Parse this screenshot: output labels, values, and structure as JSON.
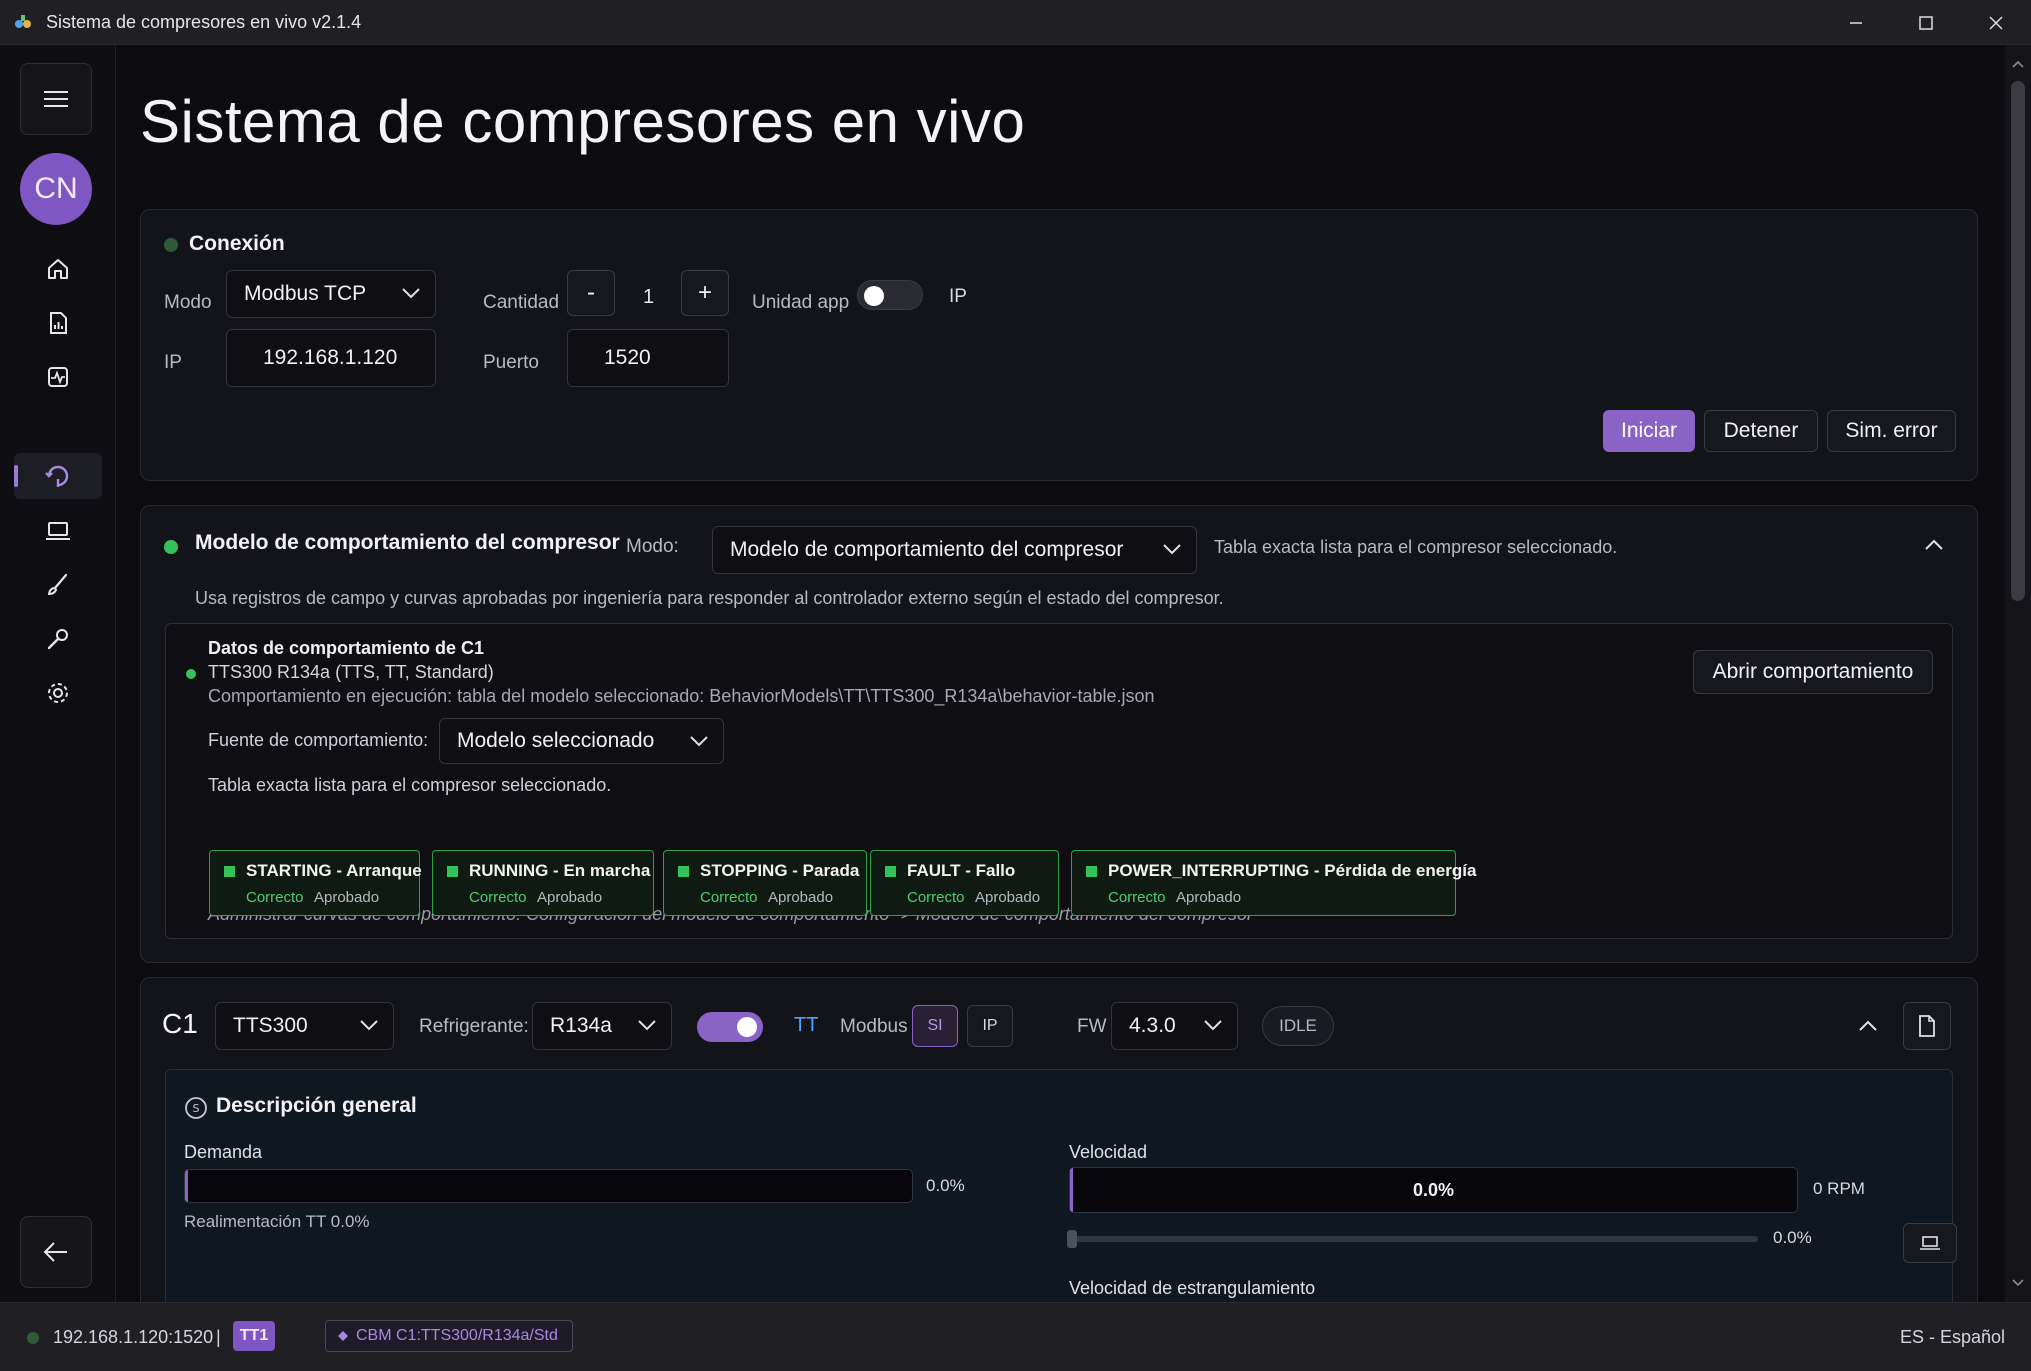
{
  "window": {
    "title": "Sistema de compresores en vivo v2.1.4",
    "minimize_icon": "minimize-icon",
    "maximize_icon": "maximize-icon",
    "close_icon": "close-icon"
  },
  "sidebar": {
    "avatar_initials": "CN",
    "items": [
      {
        "icon": "home-icon"
      },
      {
        "icon": "report-icon"
      },
      {
        "icon": "activity-icon"
      },
      {
        "icon": "compressor-icon",
        "active": true
      },
      {
        "icon": "laptop-icon"
      },
      {
        "icon": "brush-icon"
      },
      {
        "icon": "wrench-icon"
      },
      {
        "icon": "gear-icon"
      }
    ]
  },
  "page": {
    "title": "Sistema de compresores en vivo"
  },
  "connection": {
    "title": "Conexión",
    "mode_label": "Modo",
    "mode_value": "Modbus TCP",
    "qty_label": "Cantidad",
    "qty_minus": "-",
    "qty_value": "1",
    "qty_plus": "+",
    "unit_label": "Unidad app",
    "ip_toggle_label": "IP",
    "ip_label": "IP",
    "ip_value": "192.168.1.120",
    "port_label": "Puerto",
    "port_value": "1520",
    "start_button": "Iniciar",
    "stop_button": "Detener",
    "sim_error_button": "Sim. error"
  },
  "behavior": {
    "title": "Modelo de comportamiento del compresor",
    "mode_label": "Modo:",
    "mode_value": "Modelo de comportamiento del compresor",
    "status_text": "Tabla exacta lista para el compresor seleccionado.",
    "description": "Usa registros de campo y curvas aprobadas por ingeniería para responder al controlador externo según el estado del compresor.",
    "data_title": "Datos de comportamiento de C1",
    "model_line": "TTS300 R134a (TTS, TT, Standard)",
    "running_line": "Comportamiento en ejecución: tabla del modelo seleccionado: BehaviorModels\\TT\\TTS300_R134a\\behavior-table.json",
    "source_label": "Fuente de comportamiento:",
    "source_value": "Modelo seleccionado",
    "ready_text": "Tabla exacta lista para el compresor seleccionado.",
    "open_button": "Abrir comportamiento",
    "states": [
      {
        "name": "STARTING - Arranque",
        "ok": "Correcto",
        "approved": "Aprobado"
      },
      {
        "name": "RUNNING - En marcha",
        "ok": "Correcto",
        "approved": "Aprobado"
      },
      {
        "name": "STOPPING - Parada",
        "ok": "Correcto",
        "approved": "Aprobado"
      },
      {
        "name": "FAULT - Fallo",
        "ok": "Correcto",
        "approved": "Aprobado"
      },
      {
        "name": "POWER_INTERRUPTING - Pérdida de energía",
        "ok": "Correcto",
        "approved": "Aprobado"
      }
    ],
    "footer_note": "Administrar curvas de comportamiento: Configuración del modelo de comportamiento -> Modelo de comportamiento del compresor"
  },
  "compressor": {
    "id": "C1",
    "model": "TTS300",
    "refrigerant_label": "Refrigerante:",
    "refrigerant_value": "R134a",
    "tt_label": "TT",
    "modbus_label": "Modbus",
    "si_button": "SI",
    "ip_button": "IP",
    "fw_label": "FW",
    "fw_value": "4.3.0",
    "status_pill": "IDLE",
    "overview": {
      "title": "Descripción general",
      "demand_label": "Demanda",
      "demand_value": "0.0%",
      "demand_fraction": 0.0,
      "feedback_text": "Realimentación TT 0.0%",
      "speed_label": "Velocidad",
      "speed_bar_text": "0.0%",
      "speed_rpm": "0 RPM",
      "slider_value": "0.0%",
      "throttle_label": "Velocidad de estrangulamiento"
    }
  },
  "statusbar": {
    "address": "192.168.1.120:1520",
    "separator": "|",
    "badge": "TT1",
    "cbm": "CBM C1:TTS300/R134a/Std",
    "language": "ES - Español"
  },
  "colors": {
    "accent": "#8a63c7",
    "ok_green": "#36c25a",
    "tt_blue": "#4aa3ff"
  }
}
